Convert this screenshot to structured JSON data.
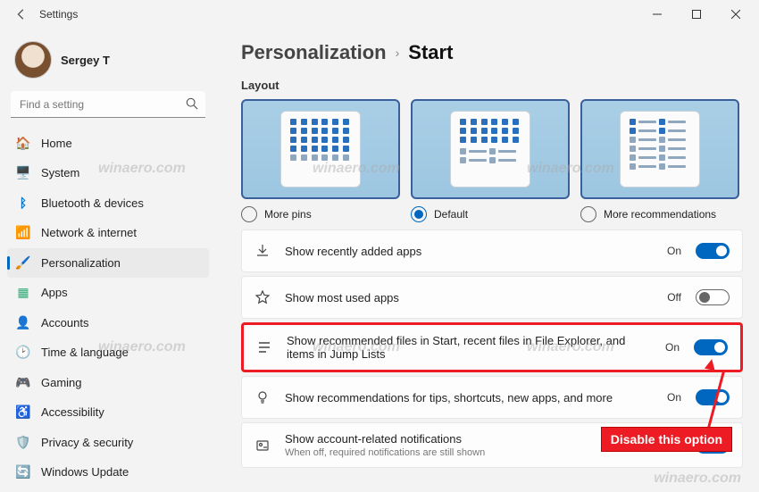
{
  "titlebar": {
    "title": "Settings"
  },
  "profile": {
    "name": "Sergey T"
  },
  "search": {
    "placeholder": "Find a setting"
  },
  "sidebar": {
    "items": [
      {
        "label": "Home",
        "icon": "🏠"
      },
      {
        "label": "System",
        "icon": "🖥️"
      },
      {
        "label": "Bluetooth & devices",
        "icon": "ᛒ"
      },
      {
        "label": "Network & internet",
        "icon": "📶"
      },
      {
        "label": "Personalization",
        "icon": "🖌️",
        "active": true
      },
      {
        "label": "Apps",
        "icon": "▦"
      },
      {
        "label": "Accounts",
        "icon": "👤"
      },
      {
        "label": "Time & language",
        "icon": "🕑"
      },
      {
        "label": "Gaming",
        "icon": "🎮"
      },
      {
        "label": "Accessibility",
        "icon": "♿"
      },
      {
        "label": "Privacy & security",
        "icon": "🛡️"
      },
      {
        "label": "Windows Update",
        "icon": "🔄"
      }
    ]
  },
  "breadcrumb": {
    "parent": "Personalization",
    "current": "Start"
  },
  "layout": {
    "label": "Layout",
    "options": [
      {
        "label": "More pins",
        "selected": false
      },
      {
        "label": "Default",
        "selected": true
      },
      {
        "label": "More recommendations",
        "selected": false
      }
    ]
  },
  "toggles": [
    {
      "icon": "download",
      "label": "Show recently added apps",
      "state": "On",
      "on": true
    },
    {
      "icon": "star",
      "label": "Show most used apps",
      "state": "Off",
      "on": false
    },
    {
      "icon": "list",
      "label": "Show recommended files in Start, recent files in File Explorer, and items in Jump Lists",
      "state": "On",
      "on": true,
      "highlight": true
    },
    {
      "icon": "bulb",
      "label": "Show recommendations for tips, shortcuts, new apps, and more",
      "state": "On",
      "on": true
    },
    {
      "icon": "card",
      "label": "Show account-related notifications",
      "sub": "When off, required notifications are still shown",
      "state": "On",
      "on": true
    }
  ],
  "callout": {
    "text": "Disable this option"
  },
  "watermark": "winaero.com"
}
